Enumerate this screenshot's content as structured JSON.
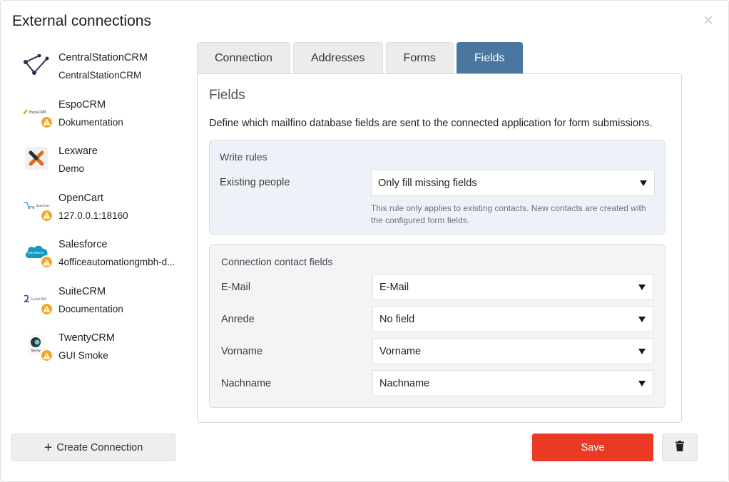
{
  "dialog": {
    "title": "External connections",
    "close_label": "×"
  },
  "connections": [
    {
      "name": "CentralStationCRM",
      "sub": "CentralStationCRM",
      "logo": "centralstation-logo",
      "warning": false
    },
    {
      "name": "EspoCRM",
      "sub": "Dokumentation",
      "logo": "espocrm-logo",
      "logo_text": "EspoCRM",
      "warning": true
    },
    {
      "name": "Lexware",
      "sub": "Demo",
      "logo": "lexware-logo",
      "logo_text": "X",
      "warning": false
    },
    {
      "name": "OpenCart",
      "sub": "127.0.0.1:18160",
      "logo": "opencart-logo",
      "logo_text": "OpenCart",
      "warning": true
    },
    {
      "name": "Salesforce",
      "sub": "4officeautomationgmbh-d...",
      "logo": "salesforce-logo",
      "logo_text": "salesforce",
      "warning": true
    },
    {
      "name": "SuiteCRM",
      "sub": "Documentation",
      "logo": "suitecrm-logo",
      "logo_text": "SuiteCRM",
      "warning": true
    },
    {
      "name": "TwentyCRM",
      "sub": "GUI Smoke",
      "logo": "twentycrm-logo",
      "logo_text": "Twenty",
      "warning": true
    }
  ],
  "tabs": [
    {
      "label": "Connection",
      "active": false
    },
    {
      "label": "Addresses",
      "active": false
    },
    {
      "label": "Forms",
      "active": false
    },
    {
      "label": "Fields",
      "active": true
    }
  ],
  "panel": {
    "title": "Fields",
    "description": "Define which mailfino database fields are sent to the connected application for form submissions."
  },
  "write_rules": {
    "title": "Write rules",
    "existing_label": "Existing people",
    "existing_value": "Only fill missing fields",
    "hint": "This rule only applies to existing contacts. New contacts are created with the configured form fields."
  },
  "contact_fields": {
    "title": "Connection contact fields",
    "rows": [
      {
        "label": "E-Mail",
        "value": "E-Mail"
      },
      {
        "label": "Anrede",
        "value": "No field"
      },
      {
        "label": "Vorname",
        "value": "Vorname"
      },
      {
        "label": "Nachname",
        "value": "Nachname"
      }
    ]
  },
  "footer": {
    "create_label": "Create Connection",
    "save_label": "Save",
    "delete_icon": "trash-icon"
  },
  "colors": {
    "tab_active": "#4a76a0",
    "save": "#ea3a26",
    "warning": "#f5a623"
  }
}
